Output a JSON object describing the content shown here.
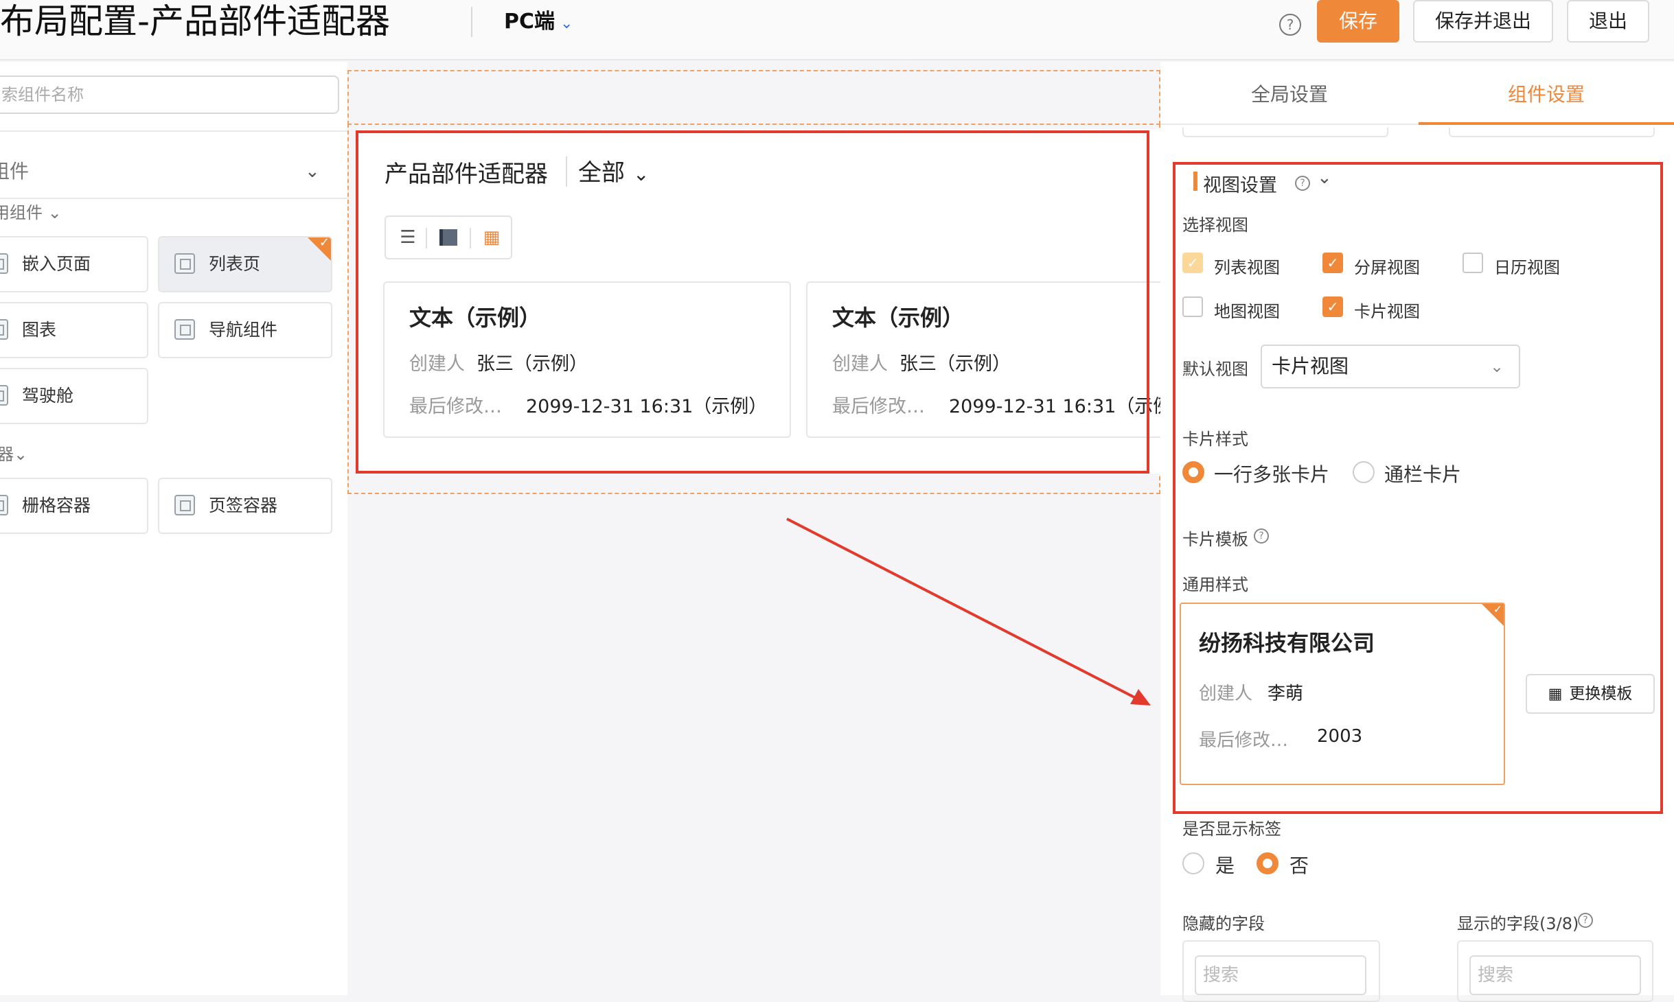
{
  "header": {
    "title": "布局配置-产品部件适配器",
    "platform": "PC端",
    "help_label": "?",
    "save_label": "保存",
    "save_exit_label": "保存并退出",
    "exit_label": "退出"
  },
  "left_panel": {
    "search_placeholder": "索组件名称",
    "category_select": "组件",
    "groups": [
      {
        "label": "用组件",
        "items": [
          "嵌入页面",
          "列表页",
          "图表",
          "导航组件",
          "驾驶舱"
        ]
      },
      {
        "label": "器",
        "items": [
          "栅格容器",
          "页签容器"
        ]
      }
    ],
    "active_item": "列表页"
  },
  "canvas": {
    "widget_title": "产品部件适配器",
    "filter_label": "全部",
    "view_switch": [
      "list-icon",
      "split-icon",
      "card-grid-icon"
    ],
    "cards": [
      {
        "title": "文本（示例）",
        "creator_label": "创建人",
        "creator": "张三（示例）",
        "modified_label": "最后修改…",
        "modified": "2099-12-31 16:31（示例）"
      },
      {
        "title": "文本（示例）",
        "creator_label": "创建人",
        "creator": "张三（示例）",
        "modified_label": "最后修改…",
        "modified": "2099-12-31 16:31（示例"
      }
    ]
  },
  "right_panel": {
    "tabs": [
      "全局设置",
      "组件设置"
    ],
    "active_tab": "组件设置",
    "view_settings": {
      "title": "视图设置",
      "select_view_label": "选择视图",
      "views": [
        {
          "label": "列表视图",
          "state": "checked-disabled"
        },
        {
          "label": "分屏视图",
          "state": "checked"
        },
        {
          "label": "日历视图",
          "state": "unchecked"
        },
        {
          "label": "地图视图",
          "state": "unchecked"
        },
        {
          "label": "卡片视图",
          "state": "checked"
        }
      ],
      "default_view_label": "默认视图",
      "default_view_value": "卡片视图",
      "card_style_label": "卡片样式",
      "card_styles": [
        "一行多张卡片",
        "通栏卡片"
      ],
      "card_style_selected": "一行多张卡片",
      "card_template_label": "卡片模板",
      "general_style_label": "通用样式",
      "template_card": {
        "title": "纷扬科技有限公司",
        "creator_label": "创建人",
        "creator": "李萌",
        "modified_label": "最后修改…",
        "modified": "2003"
      },
      "swap_template_label": "更换模板"
    },
    "show_label": {
      "label": "是否显示标签",
      "options": [
        "是",
        "否"
      ],
      "selected": "否"
    },
    "hidden_fields_label": "隐藏的字段",
    "shown_fields_label": "显示的字段(3/8)",
    "search_placeholder": "搜索"
  },
  "colors": {
    "accent": "#f0883a",
    "highlight_red": "#e23b2e",
    "checkbox_disabled": "#fbd89a"
  }
}
